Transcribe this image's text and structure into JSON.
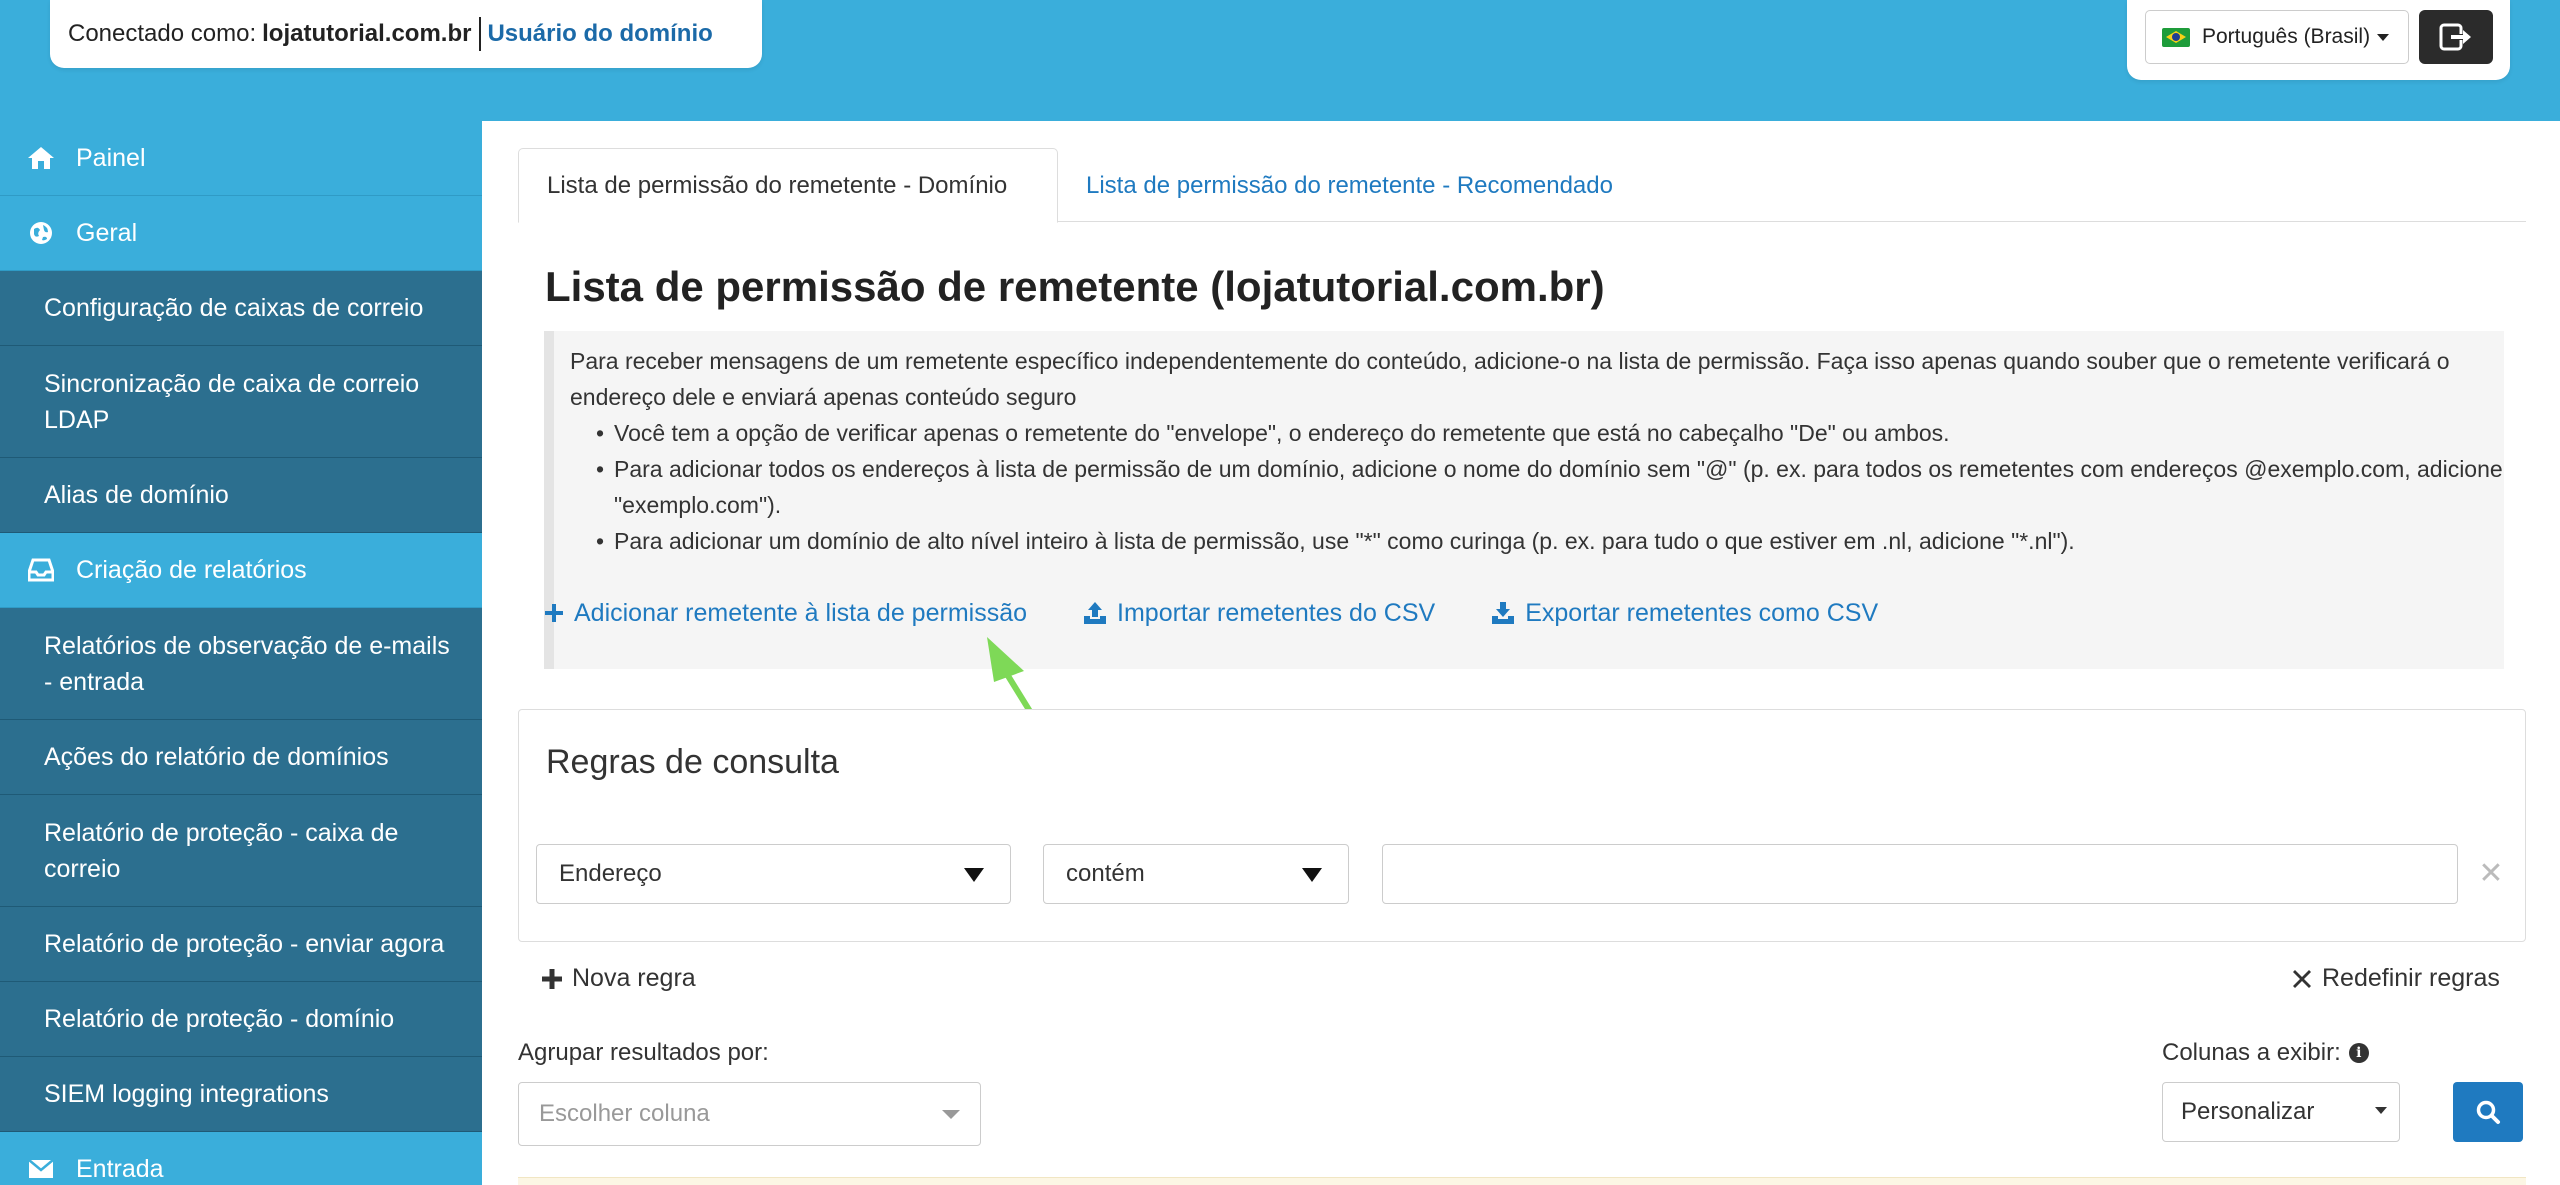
{
  "header": {
    "connected_label": "Conectado como:",
    "connected_domain": "lojatutorial.com.br",
    "user_type": "Usuário do domínio",
    "language": "Português (Brasil)",
    "colors": {
      "header_bg": "#3aaedb",
      "sidebar_bg": "#2c6f8f",
      "link": "#1f7ac0"
    }
  },
  "sidebar": {
    "items": [
      {
        "label": "Painel",
        "icon": "home-icon"
      },
      {
        "label": "Geral",
        "icon": "globe-icon"
      },
      {
        "label": "Configuração de caixas de correio"
      },
      {
        "label": "Sincronização de caixa de correio LDAP"
      },
      {
        "label": "Alias de domínio"
      },
      {
        "label": "Criação de relatórios",
        "icon": "inbox-icon"
      },
      {
        "label": "Relatórios de observação de e-mails - entrada"
      },
      {
        "label": "Ações do relatório de domínios"
      },
      {
        "label": "Relatório de proteção - caixa de correio"
      },
      {
        "label": "Relatório de proteção - enviar agora"
      },
      {
        "label": "Relatório de proteção - domínio"
      },
      {
        "label": "SIEM logging integrations"
      },
      {
        "label": "Entrada",
        "icon": "envelope-icon"
      }
    ]
  },
  "tabs": [
    {
      "label": "Lista de permissão do remetente - Domínio",
      "active": true
    },
    {
      "label": "Lista de permissão do remetente - Recomendado",
      "active": false
    }
  ],
  "page_title": "Lista de permissão de remetente (lojatutorial.com.br)",
  "info": {
    "intro": "Para receber mensagens de um remetente específico independentemente do conteúdo, adicione-o na lista de permissão. Faça isso apenas quando souber que o remetente verificará o endereço dele e enviará apenas conteúdo seguro",
    "bullets": [
      "Você tem a opção de verificar apenas o remetente do \"envelope\", o endereço do remetente que está no cabeçalho \"De\" ou ambos.",
      "Para adicionar todos os endereços à lista de permissão de um domínio, adicione o nome do domínio sem \"@\" (p. ex. para todos os remetentes com endereços @exemplo.com, adicione \"exemplo.com\").",
      "Para adicionar um domínio de alto nível inteiro à lista de permissão, use \"*\" como curinga (p. ex. para tudo o que estiver em .nl, adicione \"*.nl\")."
    ]
  },
  "actions": {
    "add": "Adicionar remetente à lista de permissão",
    "import": "Importar remetentes do CSV",
    "export": "Exportar remetentes como CSV"
  },
  "rules": {
    "title": "Regras de consulta",
    "field_value": "Endereço",
    "operator_value": "contém",
    "query_value": "",
    "new_rule": "Nova regra",
    "reset_rules": "Redefinir regras"
  },
  "grouping": {
    "label": "Agrupar resultados por:",
    "placeholder": "Escolher coluna"
  },
  "columns": {
    "label": "Colunas a exibir:",
    "value": "Personalizar"
  }
}
